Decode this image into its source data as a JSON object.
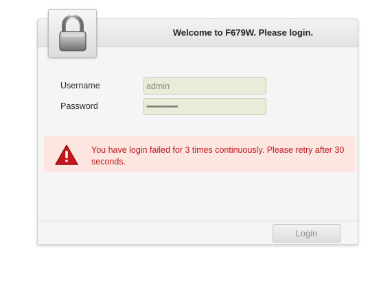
{
  "header": {
    "title": "Welcome to F679W. Please login.",
    "icon": "padlock-icon"
  },
  "form": {
    "username_label": "Username",
    "username_value": "admin",
    "password_label": "Password",
    "password_value": "••••••••••••••••"
  },
  "alert": {
    "icon": "warning-triangle-icon",
    "message": "You have login failed for 3 times continuously. Please retry after 30 seconds.",
    "color": "#c0161b",
    "background": "#fde6e0"
  },
  "footer": {
    "login_label": "Login"
  }
}
